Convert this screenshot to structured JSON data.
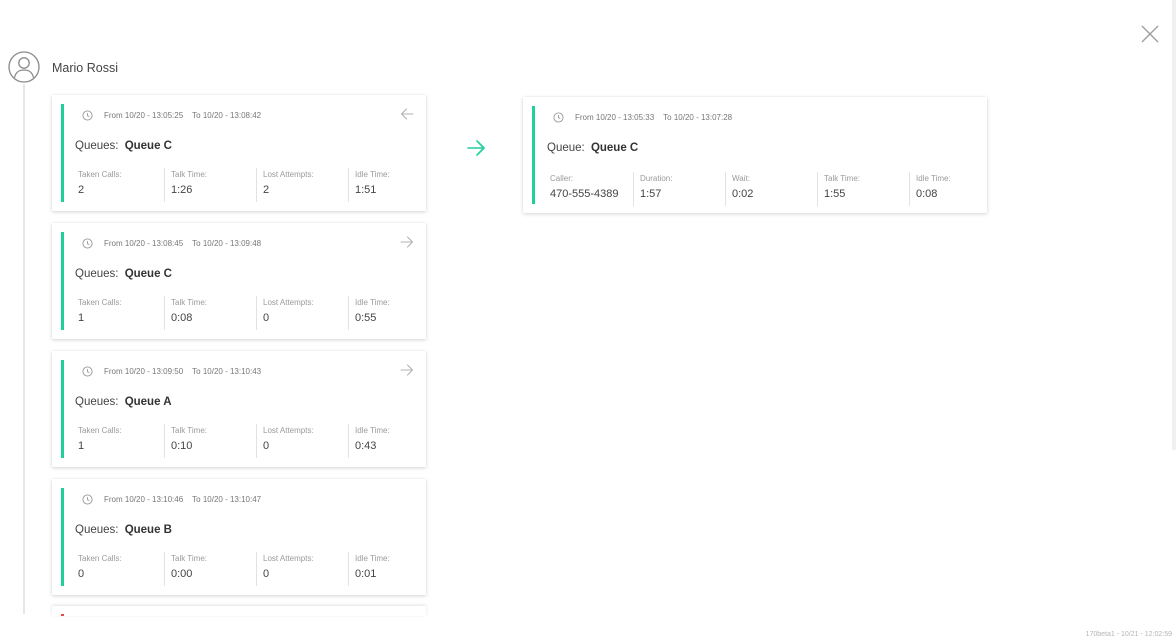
{
  "header": {
    "user_name": "Mario Rossi"
  },
  "colors": {
    "accent": "#1dd19b",
    "error": "#e64b4b"
  },
  "icons": {
    "avatar": "user-circle-icon",
    "close": "close-icon",
    "clock": "clock-icon",
    "arrow_left": "arrow-left-icon",
    "arrow_right": "arrow-right-icon"
  },
  "sessions": [
    {
      "from": "From 10/20 - 13:05:25",
      "to": "To 10/20 - 13:08:42",
      "queues_label": "Queues:",
      "queue": "Queue C",
      "arrow": "left",
      "stats": [
        {
          "label": "Taken Calls:",
          "value": "2"
        },
        {
          "label": "Talk Time:",
          "value": "1:26"
        },
        {
          "label": "Lost Attempts:",
          "value": "2"
        },
        {
          "label": "Idle Time:",
          "value": "1:51"
        }
      ]
    },
    {
      "from": "From 10/20 - 13:08:45",
      "to": "To 10/20 - 13:09:48",
      "queues_label": "Queues:",
      "queue": "Queue C",
      "arrow": "right",
      "stats": [
        {
          "label": "Taken Calls:",
          "value": "1"
        },
        {
          "label": "Talk Time:",
          "value": "0:08"
        },
        {
          "label": "Lost Attempts:",
          "value": "0"
        },
        {
          "label": "Idle Time:",
          "value": "0:55"
        }
      ]
    },
    {
      "from": "From 10/20 - 13:09:50",
      "to": "To 10/20 - 13:10:43",
      "queues_label": "Queues:",
      "queue": "Queue A",
      "arrow": "right",
      "stats": [
        {
          "label": "Taken Calls:",
          "value": "1"
        },
        {
          "label": "Talk Time:",
          "value": "0:10"
        },
        {
          "label": "Lost Attempts:",
          "value": "0"
        },
        {
          "label": "Idle Time:",
          "value": "0:43"
        }
      ]
    },
    {
      "from": "From 10/20 - 13:10:46",
      "to": "To 10/20 - 13:10:47",
      "queues_label": "Queues:",
      "queue": "Queue B",
      "arrow": "none",
      "stats": [
        {
          "label": "Taken Calls:",
          "value": "0"
        },
        {
          "label": "Talk Time:",
          "value": "0:00"
        },
        {
          "label": "Lost Attempts:",
          "value": "0"
        },
        {
          "label": "Idle Time:",
          "value": "0:01"
        }
      ]
    }
  ],
  "detail": {
    "from": "From 10/20 - 13:05:33",
    "to": "To 10/20 - 13:07:28",
    "queue_label": "Queue:",
    "queue": "Queue C",
    "stats": [
      {
        "label": "Caller:",
        "value": "470-555-4389"
      },
      {
        "label": "Duration:",
        "value": "1:57"
      },
      {
        "label": "Wait:",
        "value": "0:02"
      },
      {
        "label": "Talk Time:",
        "value": "1:55"
      },
      {
        "label": "Idle Time:",
        "value": "0:08"
      }
    ]
  },
  "footer": {
    "version": "170beta1 - 10/21 - 12:02:59"
  }
}
